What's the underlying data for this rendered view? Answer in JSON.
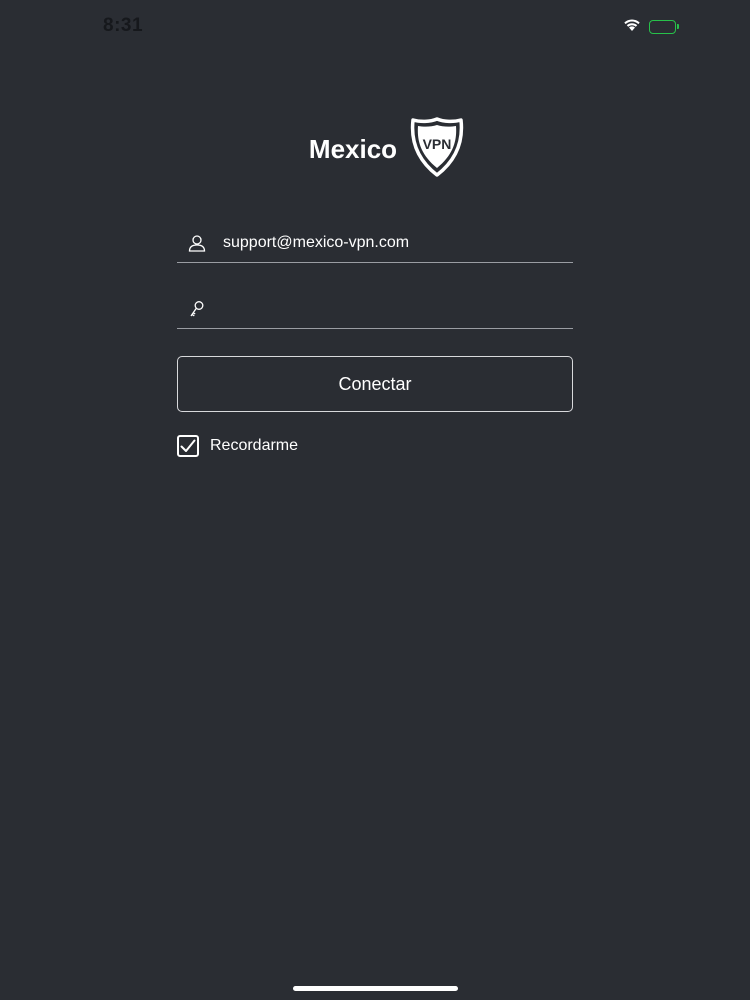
{
  "status_bar": {
    "time": "8:31",
    "wifi_icon": "wifi-icon",
    "battery_icon": "battery-charging-icon",
    "battery_color": "#27c14a"
  },
  "brand": {
    "name": "Mexico",
    "badge_text": "VPN",
    "badge_icon": "shield-icon"
  },
  "login": {
    "email_value": "support@mexico-vpn.com",
    "email_icon": "user-icon",
    "password_value": "",
    "password_icon": "key-icon",
    "connect_label": "Conectar",
    "remember_label": "Recordarme",
    "remember_checked": true
  },
  "colors": {
    "background": "#2a2d33",
    "text": "#ffffff",
    "divider": "#9a9da3"
  }
}
